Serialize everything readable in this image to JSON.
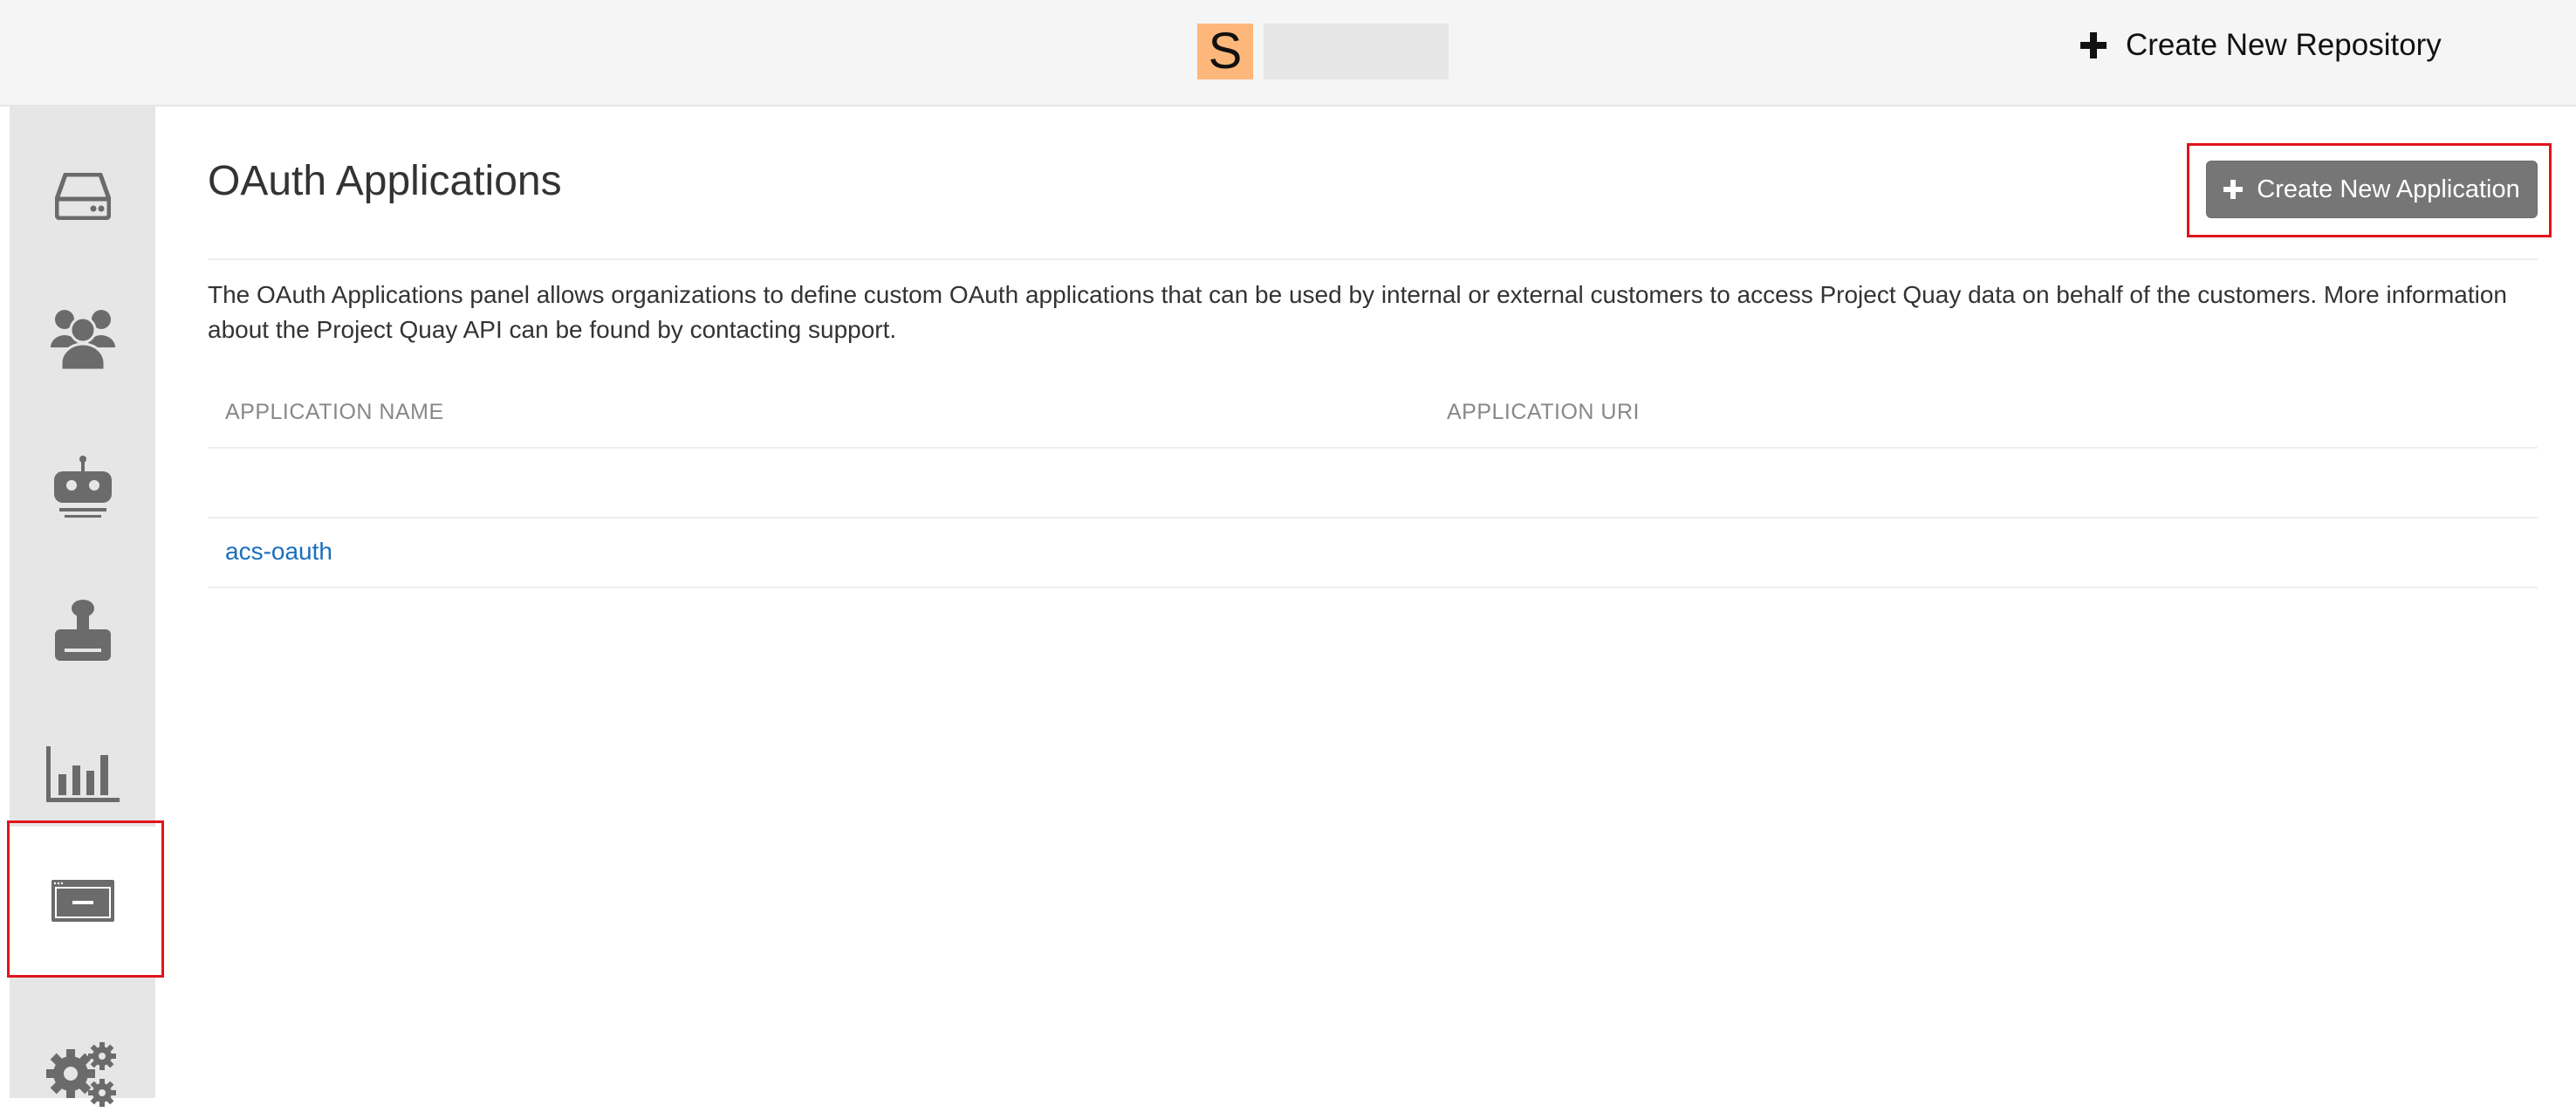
{
  "header": {
    "avatar_letter": "S",
    "avatar_color": "#fdb77a",
    "create_repo_icon": "plus-icon",
    "create_repo_label": "Create New Repository"
  },
  "sidebar": {
    "items": [
      {
        "name": "repositories",
        "icon": "hard-drive-icon",
        "active": false
      },
      {
        "name": "teams",
        "icon": "users-icon",
        "active": false
      },
      {
        "name": "robot-accounts",
        "icon": "robot-icon",
        "active": false
      },
      {
        "name": "default-permissions",
        "icon": "user-badge-icon",
        "active": false
      },
      {
        "name": "usage-logs",
        "icon": "bar-chart-icon",
        "active": false
      },
      {
        "name": "applications",
        "icon": "application-window-icon",
        "active": true
      },
      {
        "name": "settings",
        "icon": "gears-icon",
        "active": false
      }
    ],
    "highlight_color": "#e0141c"
  },
  "main": {
    "title": "OAuth Applications",
    "create_app_label": "Create New Application",
    "create_app_icon": "plus-icon",
    "button_color": "#767676",
    "description": "The OAuth Applications panel allows organizations to define custom OAuth applications that can be used by internal or external customers to access Project Quay data on behalf of the customers. More information about the Project Quay API can be found by contacting support.",
    "table": {
      "headers": [
        "APPLICATION NAME",
        "APPLICATION URI"
      ],
      "rows": [
        {
          "name": "",
          "uri": ""
        },
        {
          "name": "acs-oauth",
          "uri": ""
        }
      ]
    },
    "link_color": "#1a6ebd"
  }
}
